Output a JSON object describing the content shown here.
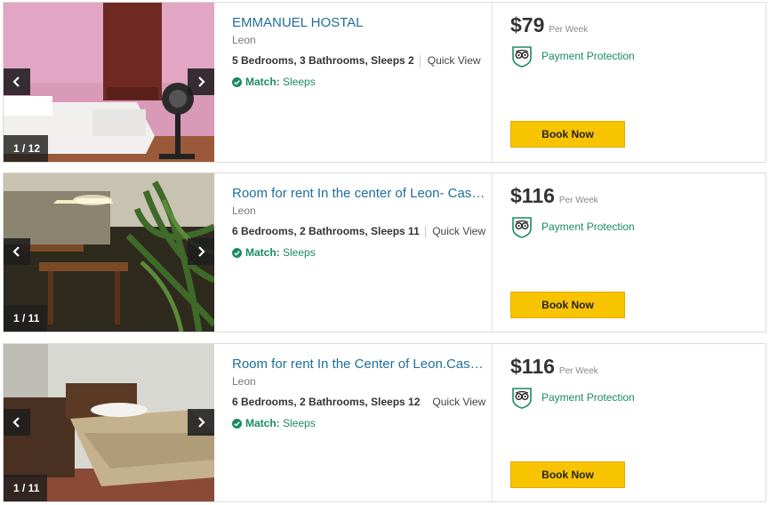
{
  "listings": [
    {
      "title": "EMMANUEL HOSTAL",
      "location": "Leon",
      "facts": "5 Bedrooms, 3 Bathrooms, Sleeps 2",
      "quick_view": "Quick View",
      "match_label": "Match:",
      "match_value": "Sleeps",
      "price": "$79",
      "price_period": "Per Week",
      "protection": "Payment Protection",
      "book_label": "Book Now",
      "photo_counter": "1 / 12"
    },
    {
      "title": "Room for rent In the center of Leon- Casa ...",
      "location": "Leon",
      "facts": "6 Bedrooms, 2 Bathrooms, Sleeps 11",
      "quick_view": "Quick View",
      "match_label": "Match:",
      "match_value": "Sleeps",
      "price": "$116",
      "price_period": "Per Week",
      "protection": "Payment Protection",
      "book_label": "Book Now",
      "photo_counter": "1 / 11"
    },
    {
      "title": "Room for rent In the Center of Leon.Casa ...",
      "location": "Leon",
      "facts": "6 Bedrooms, 2 Bathrooms, Sleeps 12",
      "quick_view": "Quick View",
      "match_label": "Match:",
      "match_value": "Sleeps",
      "price": "$116",
      "price_period": "Per Week",
      "protection": "Payment Protection",
      "book_label": "Book Now",
      "photo_counter": "1 / 11"
    }
  ],
  "colors": {
    "title_link": "#1f6f9a",
    "accent_green": "#1a8a63",
    "book_button": "#f8c400"
  },
  "icons": {
    "prev": "chevron-left-icon",
    "next": "chevron-right-icon",
    "match": "check-circle-icon",
    "protection": "tripadvisor-shield-icon"
  }
}
